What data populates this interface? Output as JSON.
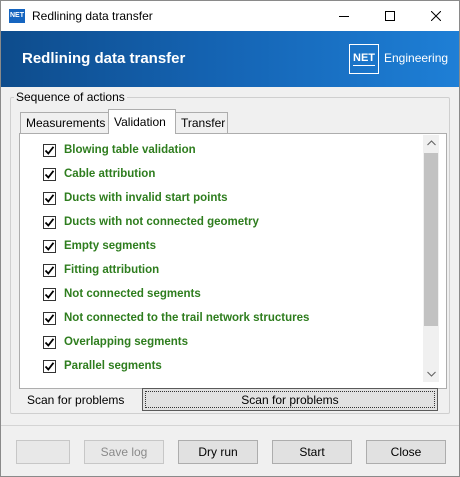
{
  "window": {
    "title": "Redlining data transfer",
    "icon_text": "NET"
  },
  "banner": {
    "title": "Redlining data transfer",
    "logo_text": "NET",
    "brand_text": "Engineering"
  },
  "group": {
    "legend": "Sequence of actions"
  },
  "tabs": [
    {
      "label": "Measurements",
      "active": false
    },
    {
      "label": "Validation",
      "active": true
    },
    {
      "label": "Transfer",
      "active": false
    }
  ],
  "validation_items": [
    {
      "label": "Blowing table validation",
      "checked": true
    },
    {
      "label": "Cable attribution",
      "checked": true
    },
    {
      "label": "Ducts with invalid start points",
      "checked": true
    },
    {
      "label": "Ducts with not connected geometry",
      "checked": true
    },
    {
      "label": "Empty segments",
      "checked": true
    },
    {
      "label": "Fitting attribution",
      "checked": true
    },
    {
      "label": "Not connected segments",
      "checked": true
    },
    {
      "label": "Not connected to the trail network structures",
      "checked": true
    },
    {
      "label": "Overlapping segments",
      "checked": true
    },
    {
      "label": "Parallel segments",
      "checked": true
    }
  ],
  "scan": {
    "label": "Scan for problems",
    "button": "Scan for problems"
  },
  "footer": {
    "blank_label": "",
    "save_log_label": "Save log",
    "dry_run_label": "Dry run",
    "start_label": "Start",
    "close_label": "Close"
  },
  "colors": {
    "banner": "#1565b5",
    "item_text": "#2e7d1e"
  }
}
